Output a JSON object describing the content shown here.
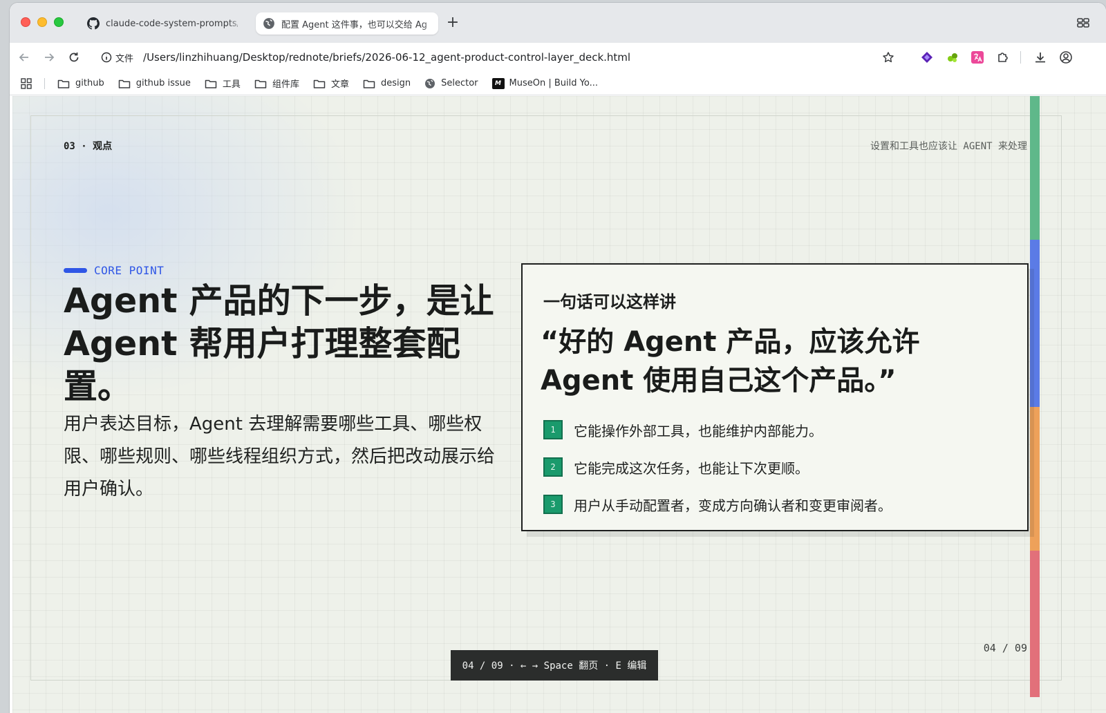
{
  "browser": {
    "tabs": [
      {
        "label": "claude-code-system-prompts/sy",
        "icon": "github-icon",
        "active": false
      },
      {
        "label": "配置 Agent 这件事，也可以交给 Ag",
        "icon": "globe-icon",
        "active": true
      }
    ],
    "new_tab_label": "+",
    "address": {
      "info_label": "文件",
      "url": "/Users/linzhihuang/Desktop/rednote/briefs/2026-06-12_agent-product-control-layer_deck.html"
    },
    "bookmarks": [
      {
        "label": "github",
        "icon": "folder-icon"
      },
      {
        "label": "github issue",
        "icon": "folder-icon"
      },
      {
        "label": "工具",
        "icon": "folder-icon"
      },
      {
        "label": "组件库",
        "icon": "folder-icon"
      },
      {
        "label": "文章",
        "icon": "folder-icon"
      },
      {
        "label": "design",
        "icon": "folder-icon"
      },
      {
        "label": "Selector",
        "icon": "globe-icon"
      },
      {
        "label": "MuseOn | Build Yo...",
        "icon": "museon-logo"
      }
    ],
    "museon_logo_text": "M"
  },
  "slide": {
    "kicker": "03 · 观点",
    "top_note": "设置和工具也应该让 AGENT 来处理",
    "core_label": "CORE POINT",
    "headline": "Agent 产品的下一步，是让 Agent 帮用户打理整套配置。",
    "lead": "用户表达目标，Agent 去理解需要哪些工具、哪些权限、哪些规则、哪些线程组织方式，然后把改动展示给用户确认。",
    "card": {
      "kicker": "一句话可以这样讲",
      "quote": "“好的 Agent 产品，应该允许 Agent 使用自己这个产品。”",
      "items": [
        {
          "num": "1",
          "text": "它能操作外部工具，也能维护内部能力。"
        },
        {
          "num": "2",
          "text": "它能完成这次任务，也能让下次更顺。"
        },
        {
          "num": "3",
          "text": "用户从手动配置者，变成方向确认者和变更审阅者。"
        }
      ]
    },
    "pager": "04 / 09",
    "hint": "04 / 09 · ← → Space 翻页 · E 编辑"
  },
  "colors": {
    "accent_blue": "#2f56e6",
    "accent_green": "#1a9a6c",
    "strip": [
      "#5fb88a",
      "#5b7be6",
      "#eea15a",
      "#e2707a"
    ]
  }
}
